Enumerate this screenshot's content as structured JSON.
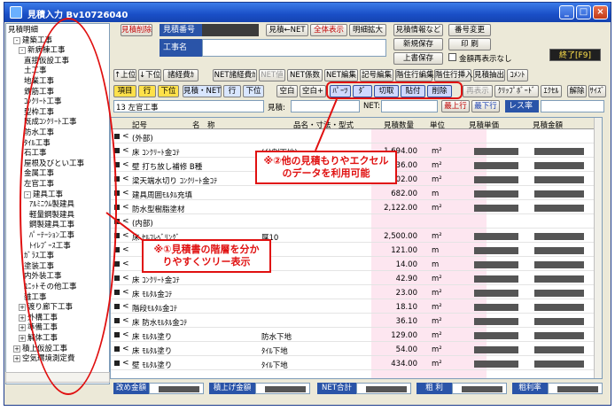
{
  "window": {
    "title": "見積入力  Bv10726040"
  },
  "tree": {
    "items": [
      {
        "label": "見積明細",
        "level": 0,
        "exp": ""
      },
      {
        "label": "建築工事",
        "level": 1,
        "exp": "-"
      },
      {
        "label": "新病棟工事",
        "level": 2,
        "exp": "-"
      },
      {
        "label": "直接仮設工事",
        "level": 3,
        "exp": ""
      },
      {
        "label": "土工事",
        "level": 3,
        "exp": ""
      },
      {
        "label": "地業工事",
        "level": 3,
        "exp": ""
      },
      {
        "label": "鉄筋工事",
        "level": 3,
        "exp": ""
      },
      {
        "label": "ｺﾝｸﾘｰﾄ工事",
        "level": 3,
        "exp": ""
      },
      {
        "label": "型枠工事",
        "level": 3,
        "exp": ""
      },
      {
        "label": "既成ｺﾝｸﾘｰﾄ工事",
        "level": 3,
        "exp": ""
      },
      {
        "label": "防水工事",
        "level": 3,
        "exp": ""
      },
      {
        "label": "ﾀｲﾙ工事",
        "level": 3,
        "exp": ""
      },
      {
        "label": "石工事",
        "level": 3,
        "exp": ""
      },
      {
        "label": "屋根及びとい工事",
        "level": 3,
        "exp": ""
      },
      {
        "label": "金属工事",
        "level": 3,
        "exp": ""
      },
      {
        "label": "左官工事",
        "level": 3,
        "exp": ""
      },
      {
        "label": "建具工事",
        "level": 3,
        "exp": "-"
      },
      {
        "label": "ｱﾙﾐﾆｳﾑ製建具",
        "level": 4,
        "exp": ""
      },
      {
        "label": "軽量鋼製建具",
        "level": 4,
        "exp": ""
      },
      {
        "label": "鋼製建具工事",
        "level": 4,
        "exp": ""
      },
      {
        "label": "ﾊﾟｰﾃｰｼｮﾝ工事",
        "level": 4,
        "exp": ""
      },
      {
        "label": "ﾄｲﾚﾌﾞｰｽ工事",
        "level": 4,
        "exp": ""
      },
      {
        "label": "ｶﾞﾗｽ工事",
        "level": 3,
        "exp": ""
      },
      {
        "label": "塗装工事",
        "level": 3,
        "exp": ""
      },
      {
        "label": "内外装工事",
        "level": 3,
        "exp": ""
      },
      {
        "label": "ﾕﾆｯﾄその他工事",
        "level": 3,
        "exp": ""
      },
      {
        "label": "雑工事",
        "level": 3,
        "exp": ""
      },
      {
        "label": "渡り廊下工事",
        "level": 2,
        "exp": "+"
      },
      {
        "label": "外構工事",
        "level": 2,
        "exp": "+"
      },
      {
        "label": "準備工事",
        "level": 2,
        "exp": "+"
      },
      {
        "label": "解体工事",
        "level": 2,
        "exp": "+"
      },
      {
        "label": "積上仮設工事",
        "level": 1,
        "exp": "+"
      },
      {
        "label": "空気環境測定費",
        "level": 1,
        "exp": "+"
      }
    ]
  },
  "header": {
    "delete_label": "見積削除",
    "mitsumori_no_label": "見積番号",
    "koji_label": "工事名",
    "net_label": "見積←NET",
    "all_view_label": "全体表示",
    "detail_zoom_label": "明細拡大",
    "info_label": "見積情報など",
    "number_change_label": "番号変更",
    "new_save_label": "新規保存",
    "print_label": "印 刷",
    "overwrite_label": "上書保存",
    "hide_amount_label": "金額再表示なし",
    "end_label": "終了[F9]"
  },
  "toolbar1": [
    "↑上位",
    "↓下位",
    "諸経費ｶ",
    "NET諸経費ｶ",
    "NET値",
    "NET係数",
    "NET編集",
    "記号編集",
    "階住行編集",
    "階住行挿入",
    "見積抽出",
    "ｺﾒﾝﾄ"
  ],
  "toolbar2": {
    "item_label": "項目",
    "row_label": "行",
    "lower_label": "下位",
    "item_net_label": "見積・NET",
    "row2_label": "行",
    "lower2_label": "下位",
    "blank_label": "空白",
    "blank_plus_label": "空白+",
    "mid_buttons": [
      "ﾊﾟｰﾂ",
      "ﾀﾞ",
      "切取",
      "貼付",
      "削除"
    ],
    "redisplay_label": "再表示",
    "clipboard_label": "ｸﾘｯﾌﾟﾎﾞｰﾄﾞ",
    "excel_label": "ｴｸｾﾙ",
    "release_label": "解除",
    "size_label": "ｻｲｽﾞ"
  },
  "infobar": {
    "path_label": "13 左官工事",
    "mitsumori_label": "見積:",
    "net_label": "NET:",
    "up_row_label": "最上行",
    "down_row_label": "最下行",
    "loss_rate_label": "レス率"
  },
  "grid": {
    "headers": [
      "記号",
      "名　称",
      "品名・寸法・型式",
      "見積数量",
      "単位",
      "見積単価",
      "見積金額"
    ],
    "rows": [
      {
        "chev": "<",
        "name": "(外部)",
        "spec": "",
        "qty": "",
        "unit": "",
        "has_price": false
      },
      {
        "chev": "<",
        "name": "床 ｺﾝｸﾘｰﾄ金ｺﾃ",
        "spec": "(分割下地)",
        "qty": "1,694.00",
        "unit": "m²",
        "has_price": true
      },
      {
        "chev": "<",
        "name": "壁 打ち放し補修 B種",
        "spec": "",
        "qty": "136.00",
        "unit": "m²",
        "has_price": true
      },
      {
        "chev": "<",
        "name": "梁天端水切り ｺﾝｸﾘｰﾄ金ｺﾃ",
        "spec": "",
        "qty": "102.00",
        "unit": "m²",
        "has_price": true
      },
      {
        "chev": "<",
        "name": "建具周囲ﾓﾙﾀﾙ充填",
        "spec": "",
        "qty": "682.00",
        "unit": "m",
        "has_price": true
      },
      {
        "chev": "<",
        "name": "防水型樹脂塗材",
        "spec": "",
        "qty": "2,122.00",
        "unit": "m²",
        "has_price": true
      },
      {
        "chev": "<",
        "name": "(内部)",
        "spec": "",
        "qty": "",
        "unit": "",
        "has_price": false
      },
      {
        "chev": "<",
        "name": "床 ｾﾙﾌﾚﾍﾞﾘﾝｸﾞ",
        "spec": "厚10",
        "qty": "2,500.00",
        "unit": "m²",
        "has_price": true
      },
      {
        "chev": "<",
        "name": "",
        "spec": "",
        "qty": "121.00",
        "unit": "m",
        "has_price": true
      },
      {
        "chev": "<",
        "name": "",
        "spec": "",
        "qty": "14.00",
        "unit": "m",
        "has_price": true
      },
      {
        "chev": "<",
        "name": "床 ｺﾝｸﾘｰﾄ金ｺﾃ",
        "spec": "",
        "qty": "42.90",
        "unit": "m²",
        "has_price": true
      },
      {
        "chev": "<",
        "name": "床 ﾓﾙﾀﾙ金ｺﾃ",
        "spec": "",
        "qty": "23.00",
        "unit": "m²",
        "has_price": true
      },
      {
        "chev": "<",
        "name": "階段ﾓﾙﾀﾙ金ｺﾃ",
        "spec": "",
        "qty": "18.10",
        "unit": "m²",
        "has_price": true
      },
      {
        "chev": "<",
        "name": "床 防水ﾓﾙﾀﾙ金ｺﾃ",
        "spec": "",
        "qty": "36.10",
        "unit": "m²",
        "has_price": true
      },
      {
        "chev": "<",
        "name": "床 ﾓﾙﾀﾙ塗り",
        "spec": "防水下地",
        "qty": "129.00",
        "unit": "m²",
        "has_price": true
      },
      {
        "chev": "<",
        "name": "床 ﾓﾙﾀﾙ塗り",
        "spec": "ﾀｲﾙ下地",
        "qty": "54.00",
        "unit": "m²",
        "has_price": true
      },
      {
        "chev": "<",
        "name": "壁 ﾓﾙﾀﾙ塗り",
        "spec": "ﾀｲﾙ下地",
        "qty": "434.00",
        "unit": "m²",
        "has_price": true
      }
    ]
  },
  "status": {
    "cut_amount_label": "改め金額",
    "sum_label": "積上げ金額",
    "net_total_label": "NET合計",
    "gross_label": "粗 利",
    "gross_rate_label": "粗利率"
  },
  "annotations": {
    "callout1": [
      "※②他の見積もりやエクセル",
      "のデータを利用可能"
    ],
    "callout2": [
      "※①見積書の階層を分か",
      "りやすくツリー表示"
    ]
  }
}
